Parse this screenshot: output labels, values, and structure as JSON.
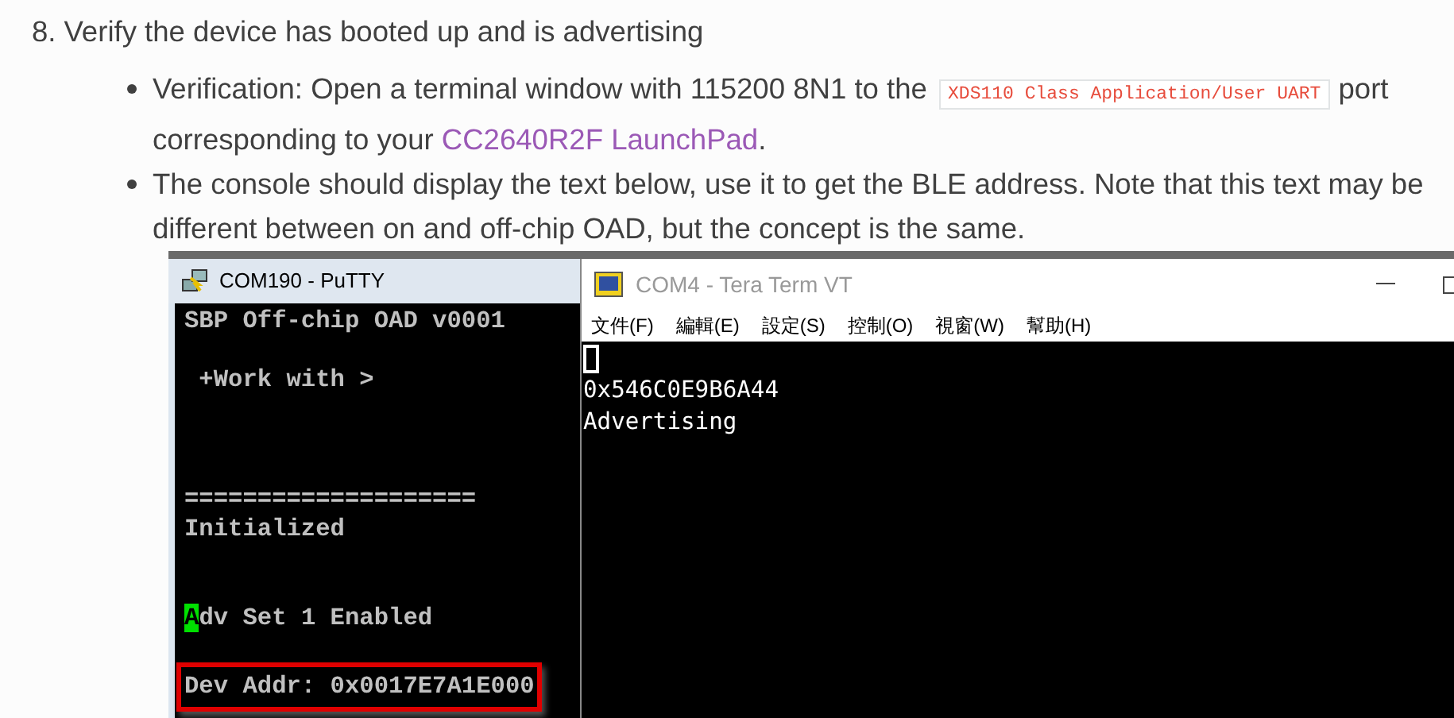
{
  "step": {
    "number": "8.",
    "title": "Verify the device has booted up and is advertising"
  },
  "bullets": [
    {
      "parts": [
        {
          "kind": "text",
          "text": "Verification: Open a terminal window with 115200 8N1 to the "
        },
        {
          "kind": "code",
          "text": "XDS110 Class Application/User UART"
        },
        {
          "kind": "text",
          "text": " port corresponding to your "
        },
        {
          "kind": "link",
          "text": "CC2640R2F LaunchPad"
        },
        {
          "kind": "text",
          "text": "."
        }
      ]
    },
    {
      "parts": [
        {
          "kind": "text",
          "text": "The console should display the text below, use it to get the BLE address. Note that this text may be different between on and off-chip OAD, but the concept is the same."
        }
      ]
    }
  ],
  "screenshot": {
    "putty": {
      "title": "COM190 - PuTTY",
      "lines": [
        {
          "kind": "plain",
          "text": "SBP Off-chip OAD v0001"
        },
        {
          "kind": "plain",
          "text": " +Work with >"
        },
        {
          "kind": "plain",
          "text": "===================="
        },
        {
          "kind": "plain",
          "text": "Initialized"
        },
        {
          "kind": "cursor",
          "text": "Adv Set 1 Enabled"
        },
        {
          "kind": "boxed",
          "text": "Dev Addr: 0x0017E7A1E000"
        }
      ]
    },
    "teraterm": {
      "title": "COM4 - Tera Term VT",
      "menu": [
        "文件(F)",
        "編輯(E)",
        "設定(S)",
        "控制(O)",
        "視窗(W)",
        "幫助(H)"
      ],
      "cursor": true,
      "lines": [
        "0x546C0E9B6A44",
        "Advertising"
      ]
    }
  }
}
